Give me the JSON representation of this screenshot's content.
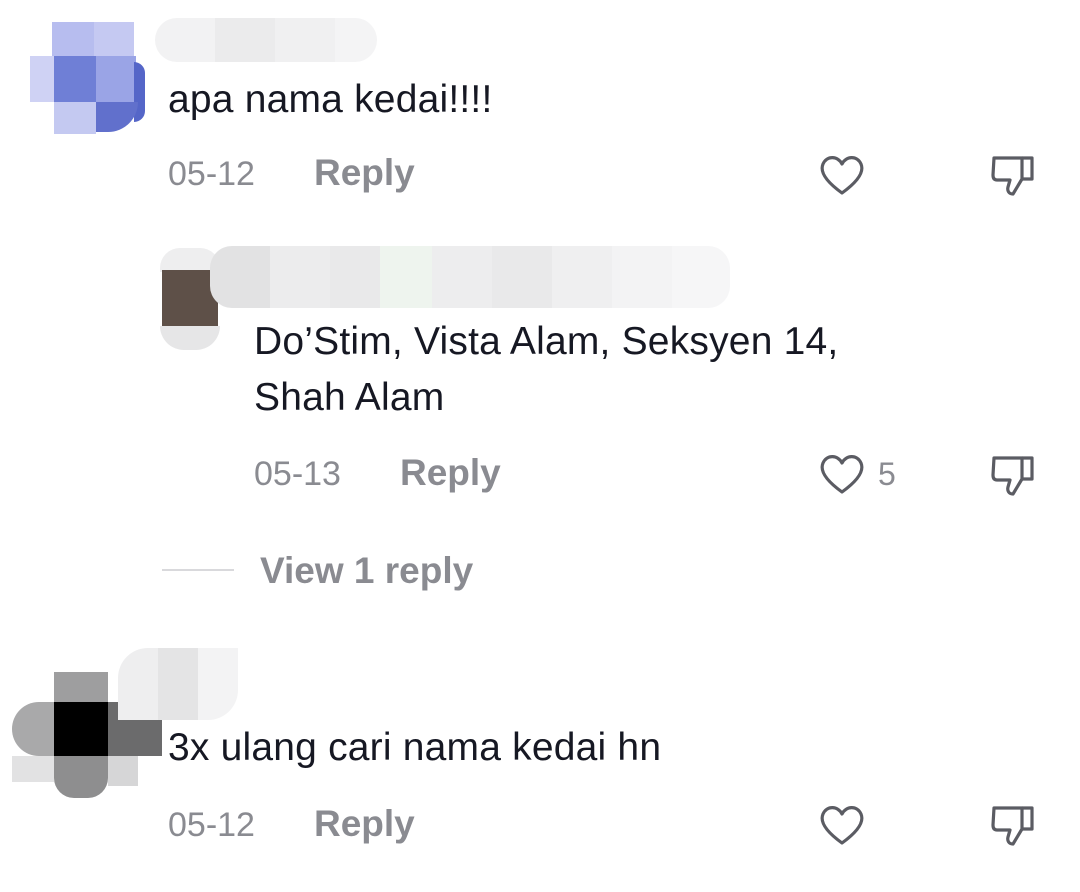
{
  "comments": [
    {
      "text": "apa nama kedai!!!!",
      "date": "05-12",
      "reply_label": "Reply",
      "liked_count": "",
      "avatar_color": "#6f7fd6"
    },
    {
      "text": "Do’Stim, Vista Alam, Seksyen 14,\nShah Alam",
      "date": "05-13",
      "reply_label": "Reply",
      "liked_count": "5",
      "avatar_color": "#5e5048"
    },
    {
      "text": "3x ulang cari nama kedai hn",
      "date": "05-12",
      "reply_label": "Reply",
      "liked_count": "",
      "avatar_color": "#000000"
    }
  ],
  "view_replies_label": "View 1 reply",
  "colors": {
    "text": "#161823",
    "muted": "#8a8b91",
    "divider": "#d9d9dc"
  },
  "icons": {
    "like": "heart-outline-icon",
    "dislike": "thumbs-down-outline-icon"
  }
}
